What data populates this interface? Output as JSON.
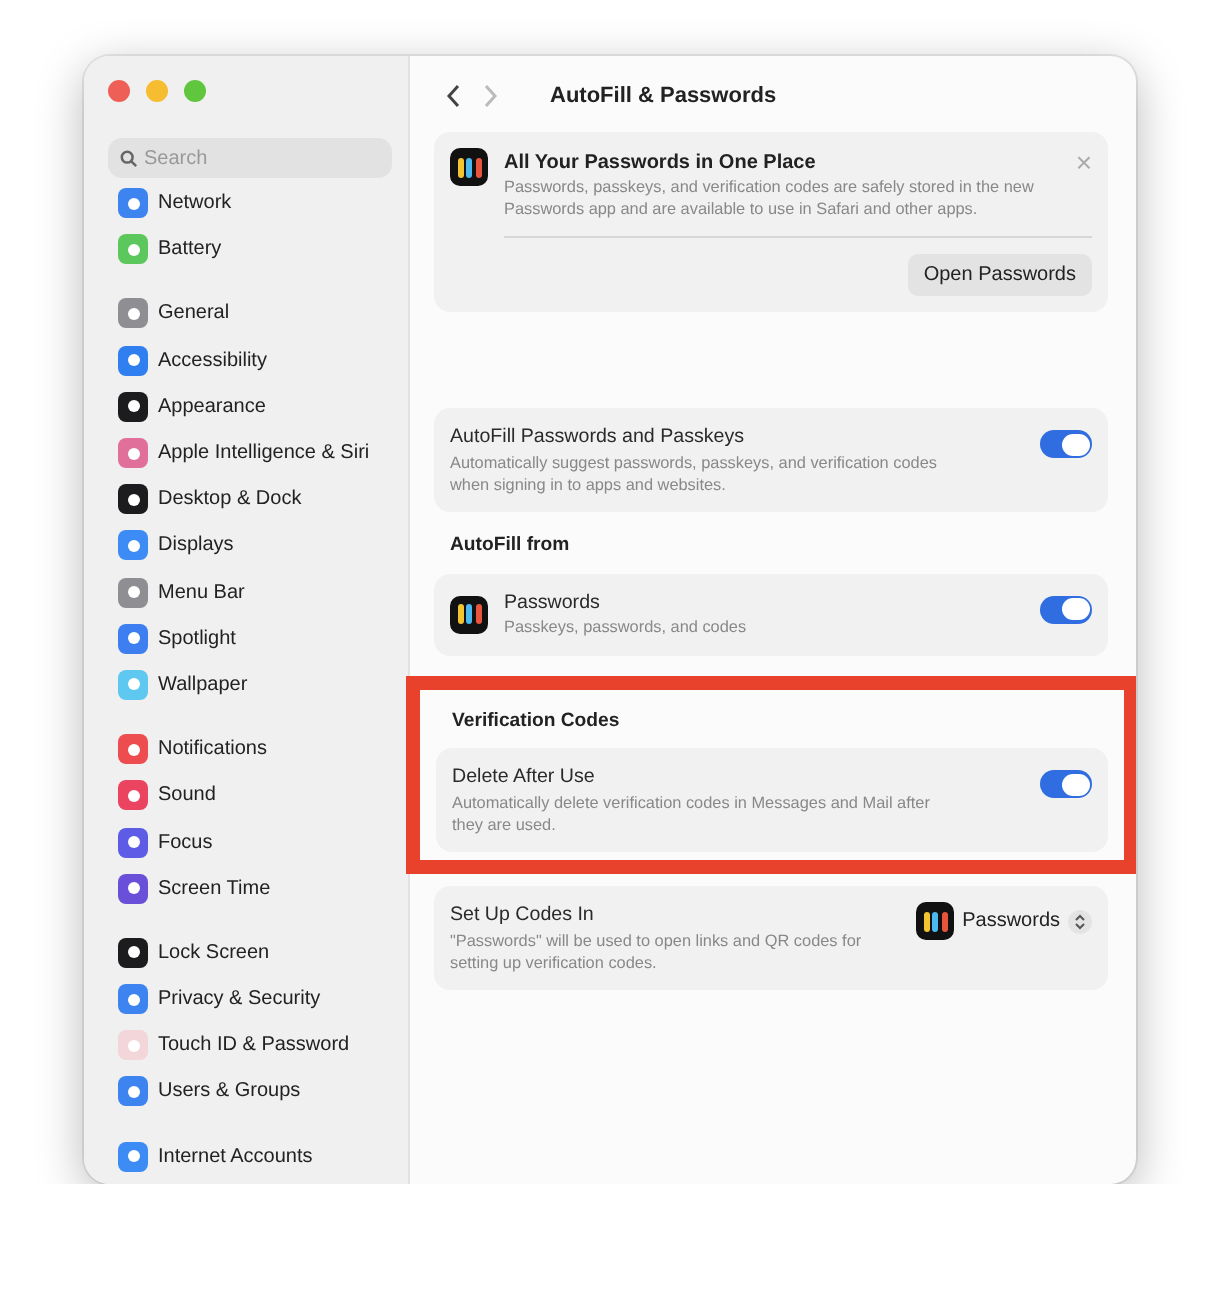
{
  "sidebar": {
    "search": {
      "placeholder": "Search"
    },
    "groups": [
      [
        {
          "label": "Network",
          "color": "#3d84f0"
        },
        {
          "label": "Battery",
          "color": "#5cc75c"
        }
      ],
      [
        {
          "label": "General",
          "color": "#8e8e93"
        },
        {
          "label": "Accessibility",
          "color": "#2f7ff0"
        },
        {
          "label": "Appearance",
          "color": "#1c1c1e"
        },
        {
          "label": "Apple Intelligence & Siri",
          "color": "#e0709a"
        },
        {
          "label": "Desktop & Dock",
          "color": "#1c1c1e"
        },
        {
          "label": "Displays",
          "color": "#3d8cf5"
        },
        {
          "label": "Menu Bar",
          "color": "#8e8e93"
        },
        {
          "label": "Spotlight",
          "color": "#3d7ff0"
        },
        {
          "label": "Wallpaper",
          "color": "#5ec8f0"
        }
      ],
      [
        {
          "label": "Notifications",
          "color": "#ee4d4f"
        },
        {
          "label": "Sound",
          "color": "#ea4460"
        },
        {
          "label": "Focus",
          "color": "#5e5ce6"
        },
        {
          "label": "Screen Time",
          "color": "#6a50d8"
        }
      ],
      [
        {
          "label": "Lock Screen",
          "color": "#1c1c1e"
        },
        {
          "label": "Privacy & Security",
          "color": "#3d84f0"
        },
        {
          "label": "Touch ID & Password",
          "color": "#f2d6da"
        },
        {
          "label": "Users & Groups",
          "color": "#3d84f0"
        }
      ],
      [
        {
          "label": "Internet Accounts",
          "color": "#3d8cf5"
        }
      ]
    ]
  },
  "header": {
    "title": "AutoFill & Passwords"
  },
  "banner": {
    "title": "All Your Passwords in One Place",
    "text": "Passwords, passkeys, and verification codes are safely stored in the new Passwords app and are available to use in Safari and other apps.",
    "close": "×",
    "button": "Open Passwords"
  },
  "sections": [
    {
      "highlighted": false,
      "rows": [
        {
          "kind": "toggle",
          "title": "AutoFill Passwords and Passkeys",
          "text": "Automatically suggest passwords, passkeys, and verification codes when signing in to apps and websites.",
          "on": true,
          "app_icon": false
        }
      ]
    },
    {
      "heading": "AutoFill from",
      "highlighted": false,
      "rows": [
        {
          "kind": "toggle",
          "title": "Passwords",
          "text": "Passkeys, passwords, and codes",
          "on": true,
          "app_icon": true
        }
      ]
    },
    {
      "heading": "Verification Codes",
      "highlighted": true,
      "rows": [
        {
          "kind": "toggle",
          "title": "Delete After Use",
          "text": "Automatically delete verification codes in Messages and Mail after they are used.",
          "on": true,
          "app_icon": false
        }
      ]
    },
    {
      "highlighted": false,
      "rows": [
        {
          "kind": "popup",
          "title": "Set Up Codes In",
          "text": "\"Passwords\" will be used to open links and QR codes for setting up verification codes.",
          "value": "Passwords",
          "app_icon": false
        }
      ]
    }
  ]
}
